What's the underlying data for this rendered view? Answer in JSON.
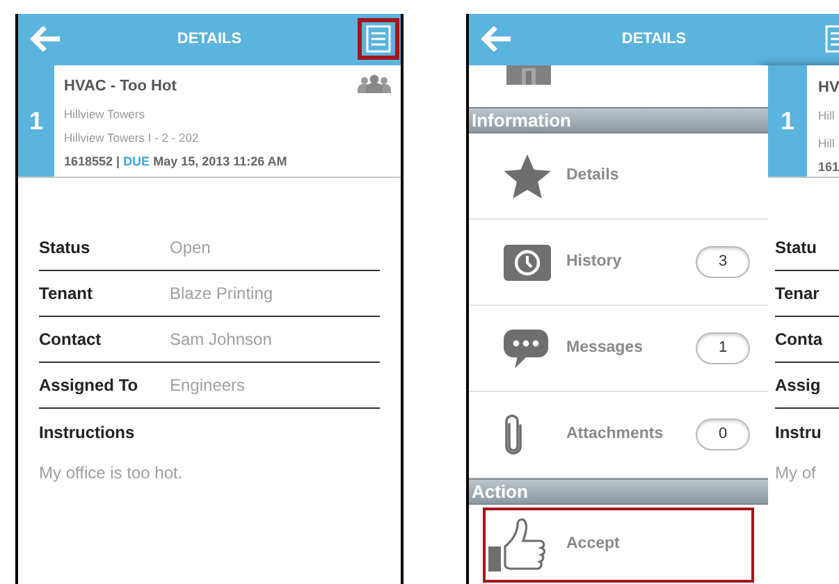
{
  "left_screen": {
    "header": {
      "title": "DETAILS"
    },
    "menu_button": {
      "highlighted": true
    },
    "work_order": {
      "number": "1",
      "title": "HVAC - Too Hot",
      "property": "Hillview Towers",
      "unit": "Hillview Towers I - 2 - 202",
      "id": "1618552",
      "separator": "|",
      "due_label": "DUE",
      "due_date": "May 15, 2013 11:26 AM"
    },
    "fields": [
      {
        "label": "Status",
        "value": "Open"
      },
      {
        "label": "Tenant",
        "value": "Blaze Printing"
      },
      {
        "label": "Contact",
        "value": "Sam Johnson"
      },
      {
        "label": "Assigned To",
        "value": "Engineers"
      }
    ],
    "instructions": {
      "label": "Instructions",
      "text": "My office is too hot."
    }
  },
  "right_screen": {
    "header": {
      "title": "DETAILS"
    },
    "menu": {
      "partial_item": {
        "kind": "building"
      },
      "sections": [
        {
          "title": "Information",
          "items": [
            {
              "kind": "star",
              "label": "Details",
              "highlighted": false
            },
            {
              "kind": "clock",
              "label": "History",
              "badge": "3",
              "highlighted": false
            },
            {
              "kind": "chat",
              "label": "Messages",
              "badge": "1",
              "highlighted": false
            },
            {
              "kind": "paperclip",
              "label": "Attachments",
              "badge": "0",
              "highlighted": false
            }
          ]
        },
        {
          "title": "Action",
          "items": [
            {
              "kind": "thumbs-up",
              "label": "Accept",
              "highlighted": true
            }
          ]
        }
      ]
    },
    "background_panel": {
      "number": "1",
      "lines": [
        "HV",
        "Hill",
        "Hill",
        "161"
      ],
      "fields": [
        "Statu",
        "Tenar",
        "Conta",
        "Assig"
      ],
      "instructions_label": "Instru",
      "instructions_text": "My of"
    }
  }
}
